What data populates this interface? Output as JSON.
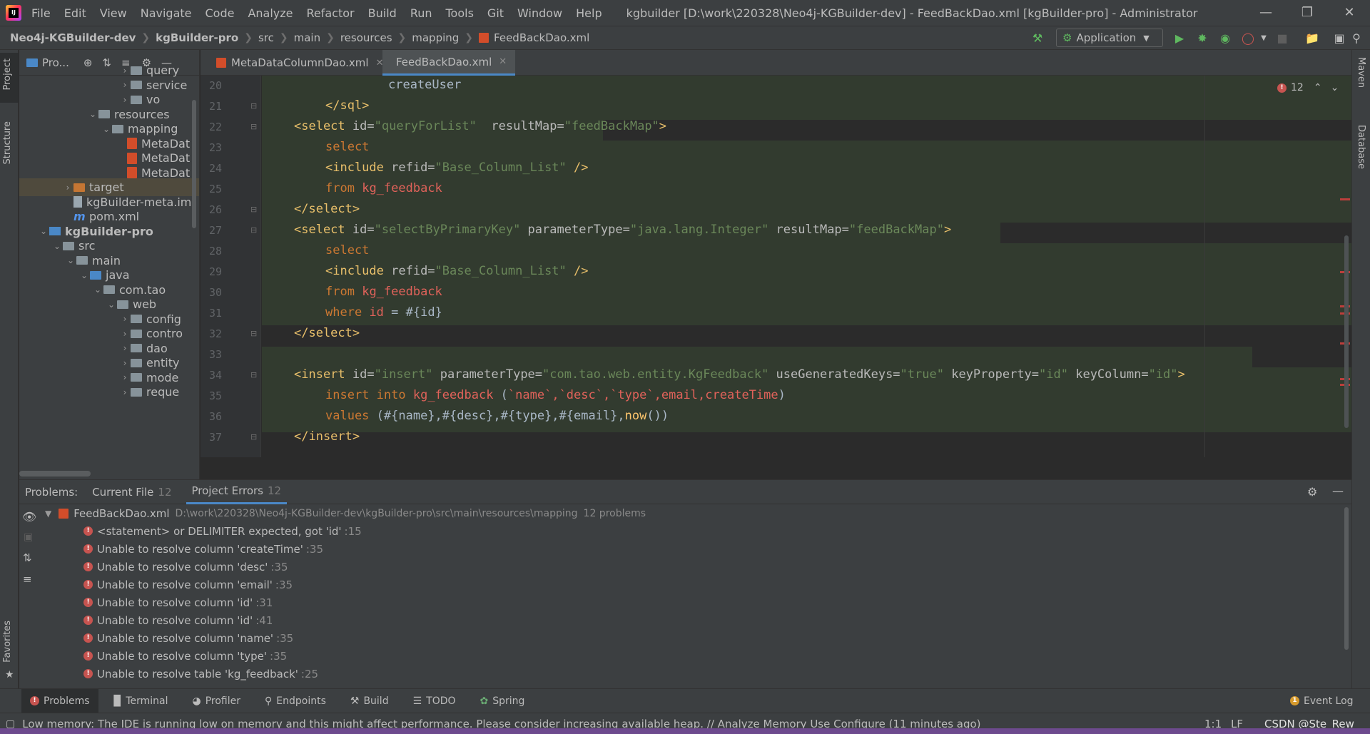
{
  "titlebar": {
    "logo_text": "IJ",
    "menu": [
      "File",
      "Edit",
      "View",
      "Navigate",
      "Code",
      "Analyze",
      "Refactor",
      "Build",
      "Run",
      "Tools",
      "Git",
      "Window",
      "Help"
    ],
    "window_title": "kgbuilder [D:\\work\\220328\\Neo4j-KGBuilder-dev] - FeedBackDao.xml [kgBuilder-pro] - Administrator"
  },
  "breadcrumb": [
    "Neo4j-KGBuilder-dev",
    "kgBuilder-pro",
    "src",
    "main",
    "resources",
    "mapping",
    "FeedBackDao.xml"
  ],
  "run_config": "Application",
  "left_strip": {
    "project": "Project",
    "structure": "Structure",
    "favorites": "Favorites"
  },
  "right_strip": {
    "maven": "Maven",
    "database": "Database"
  },
  "project_panel": {
    "title": "Pro...",
    "tree": [
      {
        "label": "query",
        "type": "folder"
      },
      {
        "label": "service",
        "type": "folder"
      },
      {
        "label": "vo",
        "type": "folder"
      },
      {
        "label": "resources",
        "type": "res"
      },
      {
        "label": "mapping",
        "type": "folder"
      },
      {
        "label": "MetaDat",
        "type": "xml"
      },
      {
        "label": "MetaDat",
        "type": "xml"
      },
      {
        "label": "MetaDat",
        "type": "xml"
      },
      {
        "label": "target",
        "type": "orange"
      },
      {
        "label": "kgBuilder-meta.iml",
        "type": "iml"
      },
      {
        "label": "pom.xml",
        "type": "m"
      },
      {
        "label": "kgBuilder-pro",
        "type": "module"
      },
      {
        "label": "src",
        "type": "folder"
      },
      {
        "label": "main",
        "type": "folder"
      },
      {
        "label": "java",
        "type": "blue"
      },
      {
        "label": "com.tao",
        "type": "folder"
      },
      {
        "label": "web",
        "type": "folder"
      },
      {
        "label": "config",
        "type": "folder"
      },
      {
        "label": "contro",
        "type": "folder"
      },
      {
        "label": "dao",
        "type": "folder"
      },
      {
        "label": "entity",
        "type": "folder"
      },
      {
        "label": "mode",
        "type": "folder"
      },
      {
        "label": "reque",
        "type": "folder"
      }
    ]
  },
  "editor": {
    "tabs": [
      {
        "label": "MetaDataColumnDao.xml",
        "active": false
      },
      {
        "label": "FeedBackDao.xml",
        "active": true
      }
    ],
    "error_count": "12",
    "line_numbers": [
      "20",
      "21",
      "22",
      "23",
      "24",
      "25",
      "26",
      "27",
      "28",
      "29",
      "30",
      "31",
      "32",
      "33",
      "34",
      "35",
      "36",
      "37"
    ],
    "code": {
      "l20": "createUser",
      "l21": "</sql>",
      "l22_tag": "<select",
      "l22_attr1": " id=",
      "l22_val1": "\"queryForList\"",
      "l22_attr2": "  resultMap=",
      "l22_val2": "\"feedBackMap\"",
      "l22_end": ">",
      "l23": "select",
      "l24_tag": "<include",
      "l24_attr": " refid=",
      "l24_val": "\"Base_Column_List\"",
      "l24_end": " />",
      "l25_kw": "from",
      "l25_tbl": "kg_feedback",
      "l26": "</select>",
      "l27_tag": "<select",
      "l27_attr1": " id=",
      "l27_val1": "\"selectByPrimaryKey\"",
      "l27_attr2": " parameterType=",
      "l27_val2": "\"java.lang.Integer\"",
      "l27_attr3": " resultMap=",
      "l27_val3": "\"feedBackMap\"",
      "l27_end": ">",
      "l28": "select",
      "l29_tag": "<include",
      "l29_attr": " refid=",
      "l29_val": "\"Base_Column_List\"",
      "l29_end": " />",
      "l30_kw": "from",
      "l30_tbl": "kg_feedback",
      "l31_kw": "where",
      "l31_col": "id",
      "l31_rest": " = #{id}",
      "l32": "</select>",
      "l34_tag": "<insert",
      "l34_attr1": " id=",
      "l34_val1": "\"insert\"",
      "l34_attr2": " parameterType=",
      "l34_val2": "\"com.tao.web.entity.KgFeedback\"",
      "l34_attr3": " useGeneratedKeys=",
      "l34_val3": "\"true\"",
      "l34_attr4": " keyProperty=",
      "l34_val4": "\"id\"",
      "l34_attr5": " keyColumn=",
      "l34_val5": "\"id\"",
      "l34_end": ">",
      "l35_kw1": "insert into",
      "l35_tbl": "kg_feedback",
      "l35_p1": " (",
      "l35_cols": "`name`,`desc`,`type`,email,createTime",
      "l35_p2": ")",
      "l36_kw": "values",
      "l36_a": " (#{name},#{desc},#{type},#{email},",
      "l36_fn": "now",
      "l36_b": "())",
      "l37": "</insert>"
    }
  },
  "problems": {
    "label": "Problems:",
    "tabs": [
      {
        "label": "Current File",
        "count": "12"
      },
      {
        "label": "Project Errors",
        "count": "12"
      }
    ],
    "file": {
      "name": "FeedBackDao.xml",
      "path": "D:\\work\\220328\\Neo4j-KGBuilder-dev\\kgBuilder-pro\\src\\main\\resources\\mapping",
      "count": "12 problems"
    },
    "items": [
      {
        "text": "<statement> or DELIMITER expected, got 'id'",
        "line": ":15"
      },
      {
        "text": "Unable to resolve column 'createTime'",
        "line": ":35"
      },
      {
        "text": "Unable to resolve column 'desc'",
        "line": ":35"
      },
      {
        "text": "Unable to resolve column 'email'",
        "line": ":35"
      },
      {
        "text": "Unable to resolve column 'id'",
        "line": ":31"
      },
      {
        "text": "Unable to resolve column 'id'",
        "line": ":41"
      },
      {
        "text": "Unable to resolve column 'name'",
        "line": ":35"
      },
      {
        "text": "Unable to resolve column 'type'",
        "line": ":35"
      },
      {
        "text": "Unable to resolve table 'kg_feedback'",
        "line": ":25"
      }
    ]
  },
  "bottom_tools": [
    "Problems",
    "Terminal",
    "Profiler",
    "Endpoints",
    "Build",
    "TODO",
    "Spring"
  ],
  "event_log": "Event Log",
  "status": {
    "message": "Low memory: The IDE is running low on memory and this might affect performance. Please consider increasing available heap. // Analyze Memory Use   Configure (11 minutes ago)",
    "position": "1:1",
    "line_sep": "LF",
    "watermark": "CSDN @Ste_Rew"
  },
  "colors": {
    "background": "#2b2b2b",
    "panel": "#3c3f41",
    "accent": "#4a88c7",
    "error": "#c75450",
    "xml_tag": "#e8bf6a",
    "xml_value": "#6a8759",
    "keyword": "#cc7832"
  }
}
